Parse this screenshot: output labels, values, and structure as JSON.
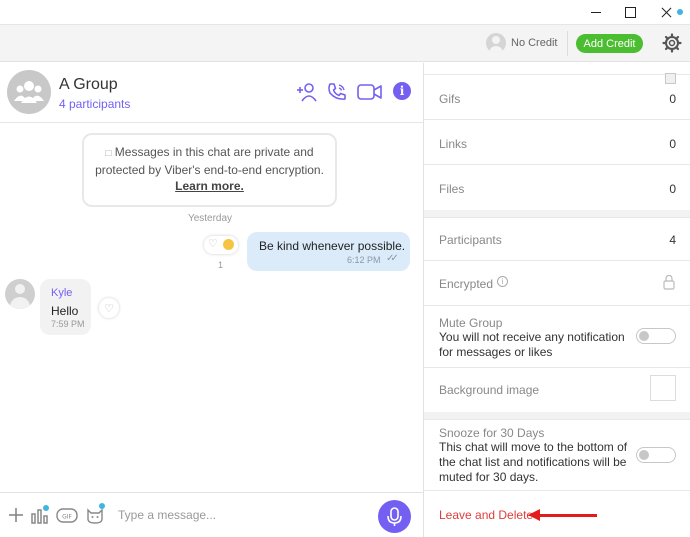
{
  "window": {
    "controls": [
      "minimize",
      "maximize",
      "close"
    ]
  },
  "topbar": {
    "credit_status": "No Credit",
    "add_credit_label": "Add Credit",
    "settings_icon": "gear-icon"
  },
  "chat_header": {
    "title": "A Group",
    "subtitle": "4 participants",
    "icons": [
      "add-participant-icon",
      "call-icon",
      "video-call-icon",
      "info-icon"
    ]
  },
  "messages": {
    "privacy_notice": "Messages in this chat are private and protected by Viber's end-to-end encryption.",
    "learn_more": "Learn more.",
    "day_separator": "Yesterday",
    "outgoing": {
      "text": "Be kind whenever possible.",
      "time": "6:12 PM",
      "reaction_count": "1"
    },
    "incoming": {
      "sender": "Kyle",
      "text": "Hello",
      "time": "7:59 PM"
    }
  },
  "composer": {
    "placeholder": "Type a message...",
    "icons": [
      "plus-icon",
      "poll-icon",
      "gif-icon",
      "sticker-icon",
      "microphone-icon"
    ]
  },
  "info_panel": {
    "rows": [
      {
        "label": "Gifs",
        "value": "0"
      },
      {
        "label": "Links",
        "value": "0"
      },
      {
        "label": "Files",
        "value": "0"
      },
      {
        "label": "Participants",
        "value": "4"
      },
      {
        "label": "Encrypted"
      }
    ],
    "mute_group": {
      "title": "Mute Group",
      "description": "You will not receive any notification for messages or likes"
    },
    "background_image": "Background image",
    "snooze": {
      "title": "Snooze for 30 Days",
      "description": "This chat will move to the bottom of the chat list and notifications will be muted for 30 days."
    },
    "leave_and_delete": "Leave and Delete"
  },
  "colors": {
    "accent": "#7360f2",
    "add_credit": "#4bbd30",
    "danger": "#e03c3c",
    "annotation_arrow": "#e41b1b"
  }
}
